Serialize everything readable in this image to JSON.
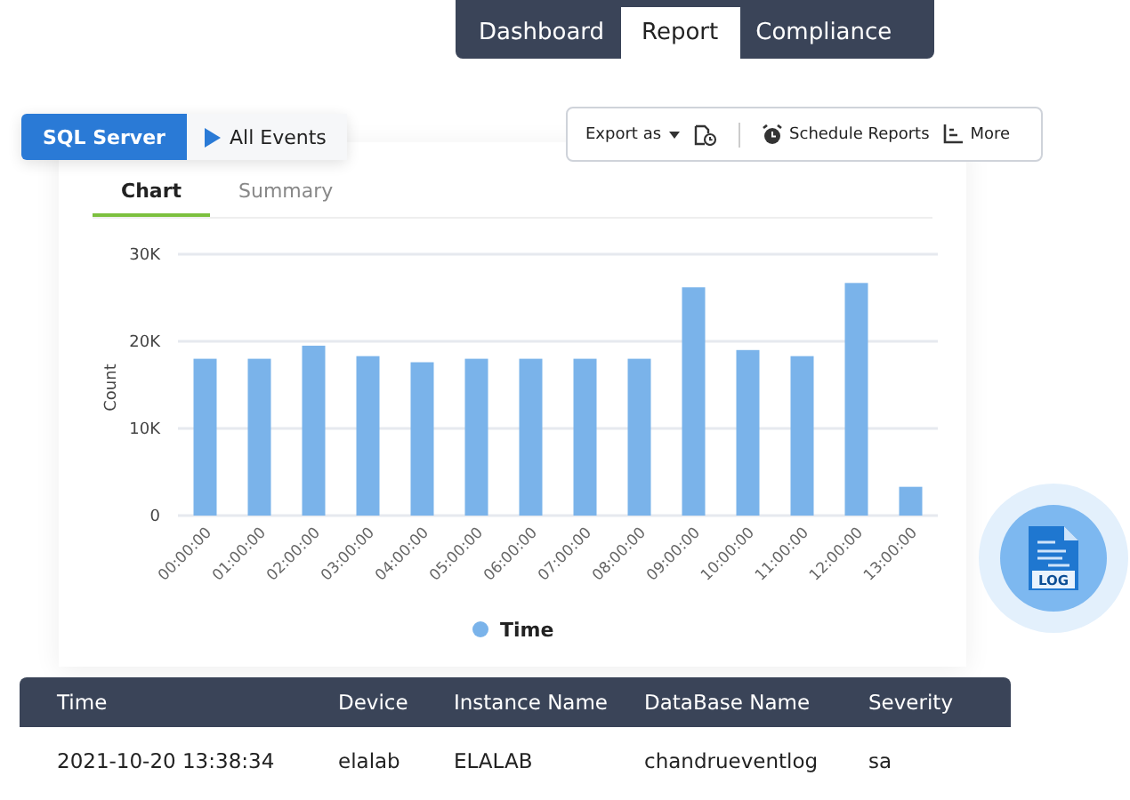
{
  "nav_tabs": [
    {
      "label": "Dashboard",
      "selected": false
    },
    {
      "label": "Report",
      "selected": true
    },
    {
      "label": "Compliance",
      "selected": false
    }
  ],
  "breadcrumb": {
    "source": "SQL Server",
    "report": "All Events"
  },
  "toolbar": {
    "export": "Export as",
    "schedule": "Schedule Reports",
    "more": "More"
  },
  "view_tabs": [
    {
      "label": "Chart",
      "selected": true
    },
    {
      "label": "Summary",
      "selected": false
    }
  ],
  "chart_data": {
    "type": "bar",
    "ylabel": "Count",
    "categories": [
      "00:00:00",
      "01:00:00",
      "02:00:00",
      "03:00:00",
      "04:00:00",
      "05:00:00",
      "06:00:00",
      "07:00:00",
      "08:00:00",
      "09:00:00",
      "10:00:00",
      "11:00:00",
      "12:00:00",
      "13:00:00"
    ],
    "series": [
      {
        "name": "Time",
        "color": "#7ab3ea",
        "values": [
          18000,
          18000,
          19500,
          18300,
          17600,
          18000,
          18000,
          18000,
          18000,
          26200,
          19000,
          18300,
          26700,
          3300
        ]
      }
    ],
    "ylim": [
      0,
      30000
    ],
    "yticks": [
      {
        "value": 0,
        "label": "0"
      },
      {
        "value": 10000,
        "label": "10K"
      },
      {
        "value": 20000,
        "label": "20K"
      },
      {
        "value": 30000,
        "label": "30K"
      }
    ]
  },
  "badge": {
    "label": "LOG"
  },
  "table": {
    "columns": [
      "Time",
      "Device",
      "Instance Name",
      "DataBase Name",
      "Severity"
    ],
    "rows": [
      [
        "2021-10-20 13:38:34",
        "elalab",
        "ELALAB",
        "chandrueventlog",
        "sa"
      ]
    ]
  }
}
